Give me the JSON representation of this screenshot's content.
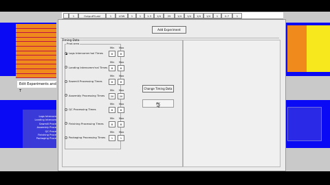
{
  "header_cells": [
    "",
    "1",
    "OutputFiLabl",
    "1",
    "LOW",
    "1",
    "1",
    "1.3",
    "1/4",
    "25",
    "1/4",
    "1/4",
    "1/4",
    "1/4",
    "1",
    "0.7",
    "1"
  ],
  "dialog": {
    "add_experiment": "Add Experiment",
    "timing_title": "Timing Data",
    "phase_group": "Prod.area",
    "min_label": "Min",
    "max_label": "Max",
    "change_button": "Change Timing Data",
    "ok_button": "OK",
    "options": [
      {
        "label": "Logs Intercomm'nal Times",
        "selected": true,
        "min": "8",
        "max": "8"
      },
      {
        "label": "Landing Intercomm'nal Times",
        "selected": false,
        "min": "8",
        "max": "8"
      },
      {
        "label": "Sawmill Processing Times",
        "selected": false,
        "min": "8",
        "max": "8"
      },
      {
        "label": "Assembly Processing Times",
        "selected": false,
        "min": "20",
        "max": "20"
      },
      {
        "label": "QC Processing Times",
        "selected": false,
        "min": "8",
        "max": "8"
      },
      {
        "label": "Finishing Processing Times",
        "selected": false,
        "min": "8",
        "max": "8"
      },
      {
        "label": "Packaging Processing Times",
        "selected": false,
        "min": "1",
        "max": "1"
      }
    ]
  },
  "sheet": {
    "edit_label": "Edit Experiments and T",
    "left_labels": [
      "Logs Intercom",
      "Landing Intercom",
      "Sawmill Proce",
      "Assembly Proce",
      "QC Proce",
      "Finishing Proce",
      "Packaging Proce"
    ]
  }
}
